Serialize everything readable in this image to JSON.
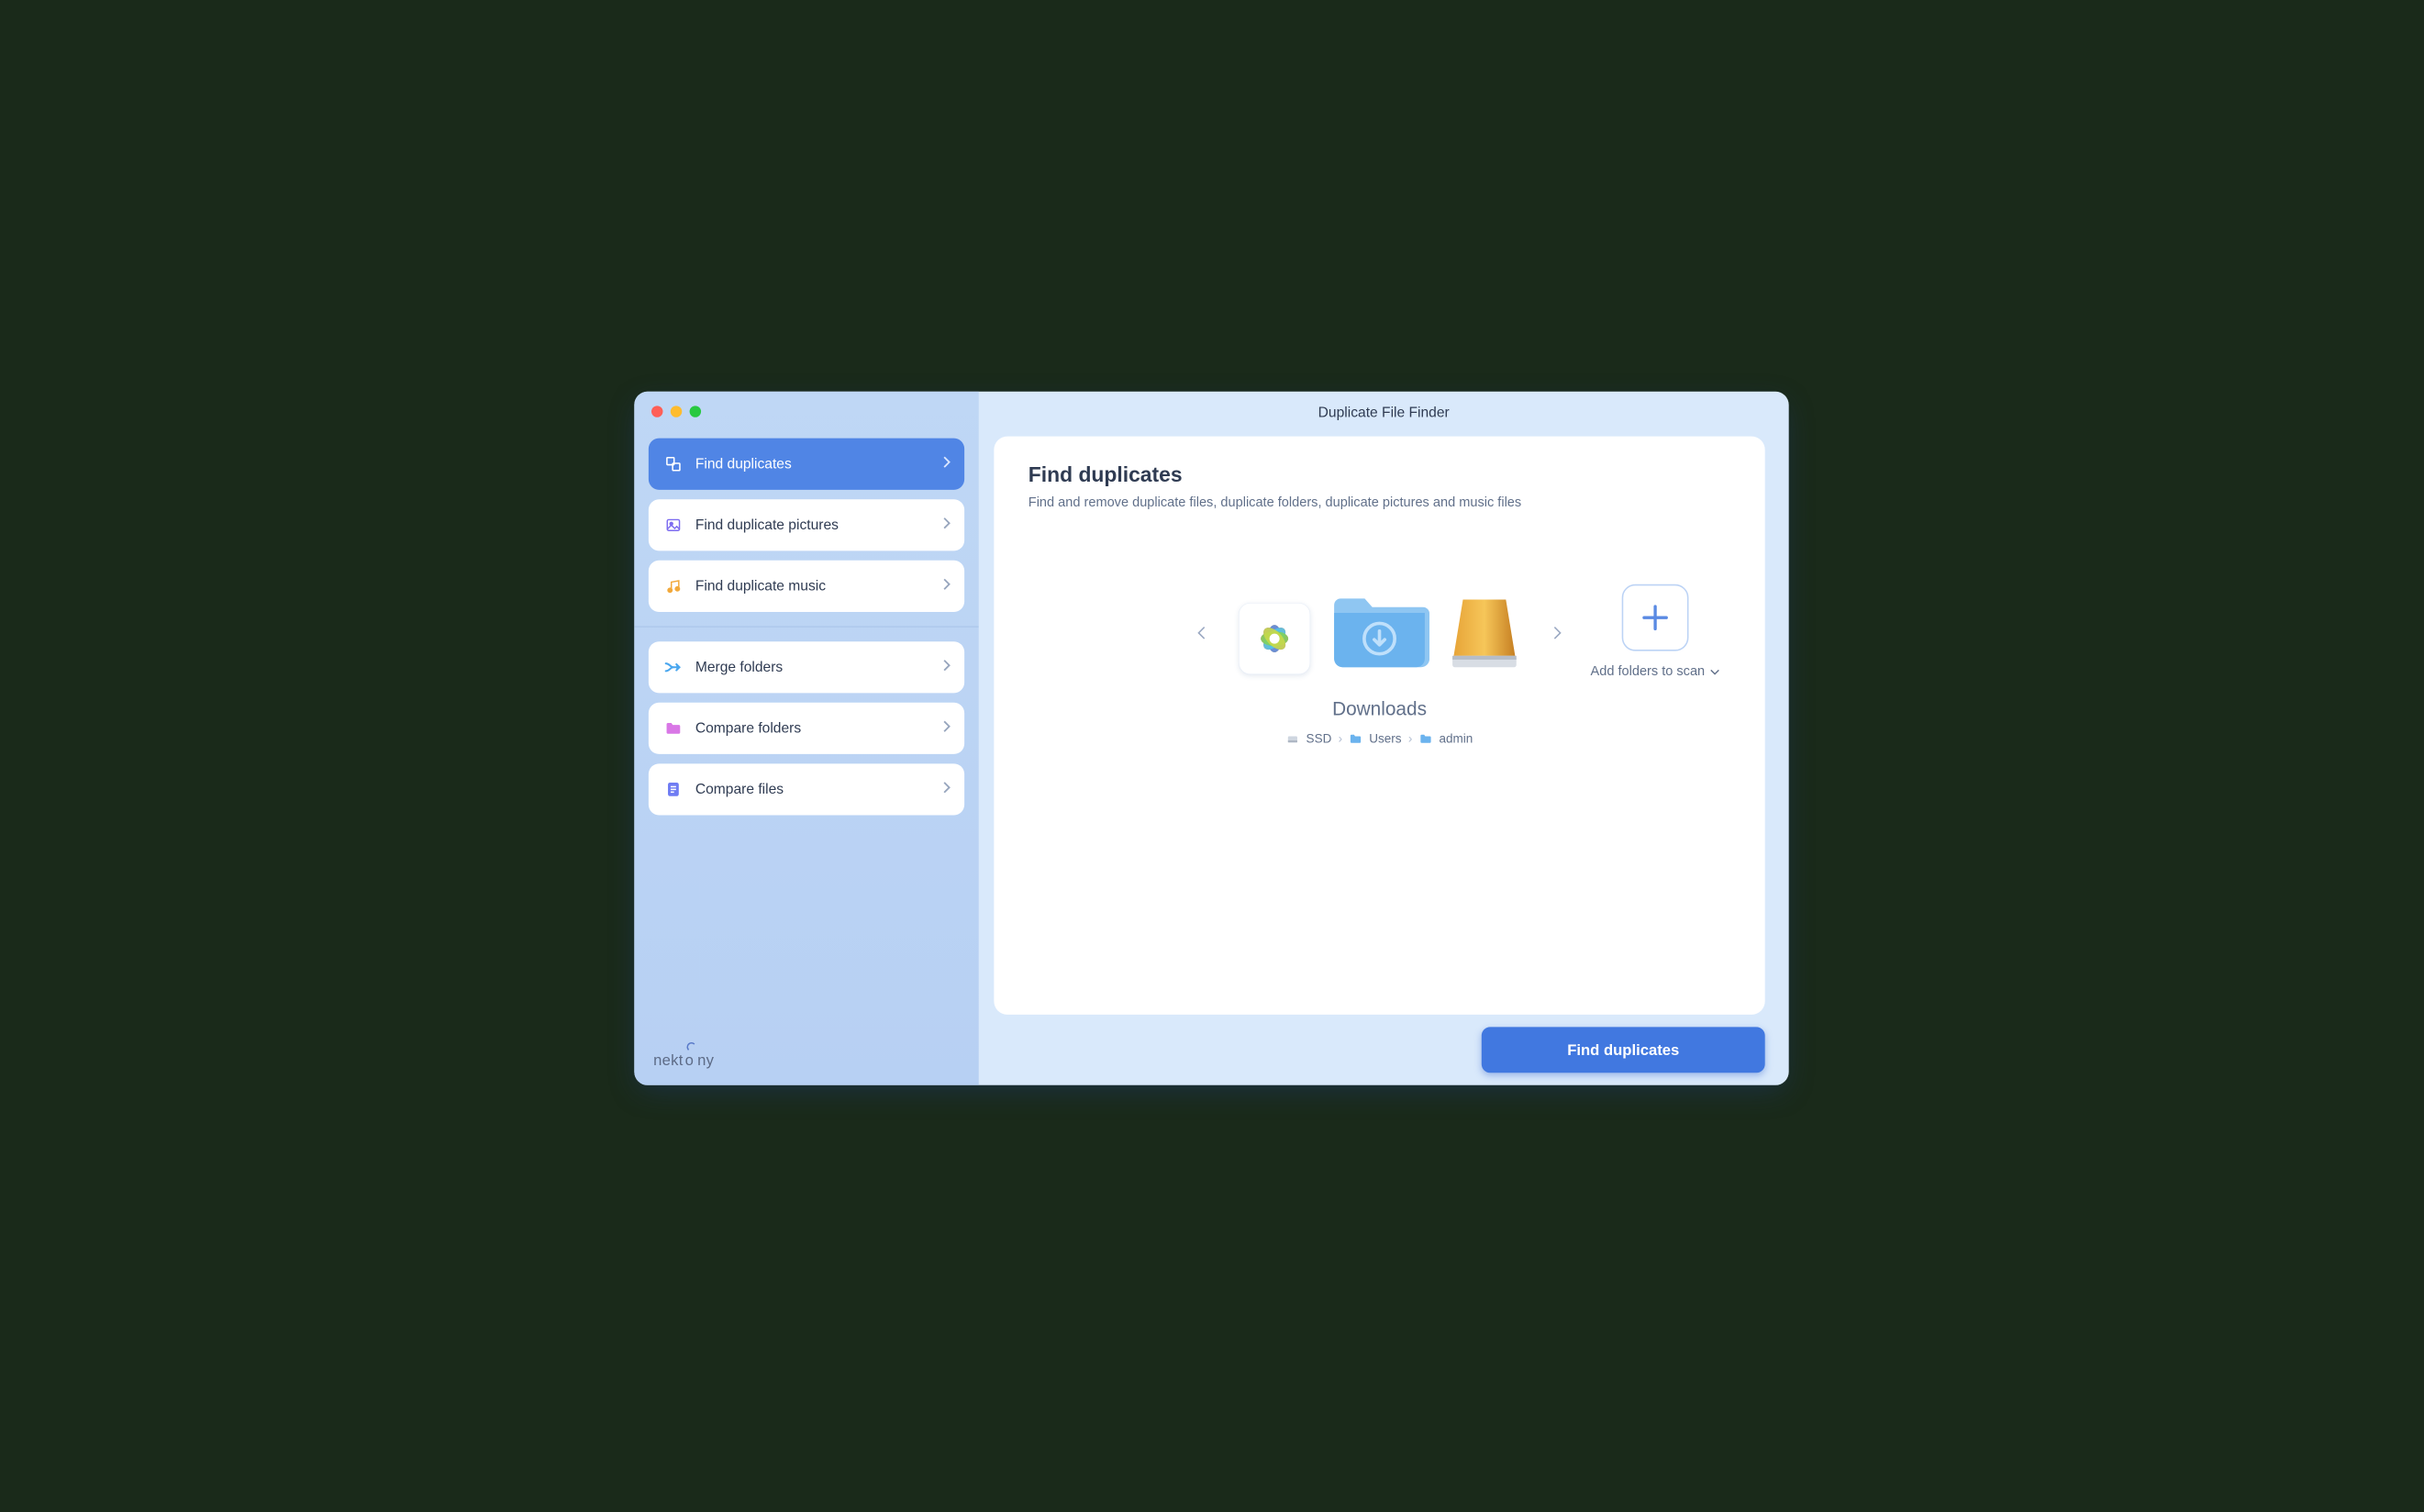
{
  "window": {
    "title": "Duplicate File Finder"
  },
  "brand": "nektony",
  "sidebar": {
    "items": [
      {
        "label": "Find duplicates",
        "icon": "layers-icon",
        "active": true
      },
      {
        "label": "Find duplicate pictures",
        "icon": "image-icon",
        "active": false
      },
      {
        "label": "Find duplicate music",
        "icon": "music-icon",
        "active": false
      },
      {
        "label": "Merge folders",
        "icon": "merge-icon",
        "active": false
      },
      {
        "label": "Compare folders",
        "icon": "folder-icon",
        "active": false
      },
      {
        "label": "Compare files",
        "icon": "document-icon",
        "active": false
      }
    ]
  },
  "page": {
    "title": "Find duplicates",
    "subtitle": "Find and remove duplicate files, duplicate folders, duplicate pictures and music files"
  },
  "targets": {
    "items": [
      {
        "kind": "photos-library",
        "icon": "photos-app-icon"
      },
      {
        "kind": "folder",
        "icon": "downloads-folder-icon",
        "selected": true
      },
      {
        "kind": "external-drive",
        "icon": "external-drive-icon"
      }
    ],
    "selected": {
      "name": "Downloads",
      "path": [
        {
          "label": "SSD",
          "icon": "internal-drive-icon"
        },
        {
          "label": "Users",
          "icon": "folder-chip-icon"
        },
        {
          "label": "admin",
          "icon": "folder-chip-icon"
        }
      ]
    }
  },
  "add": {
    "label": "Add folders to scan"
  },
  "actions": {
    "primary": "Find duplicates"
  }
}
